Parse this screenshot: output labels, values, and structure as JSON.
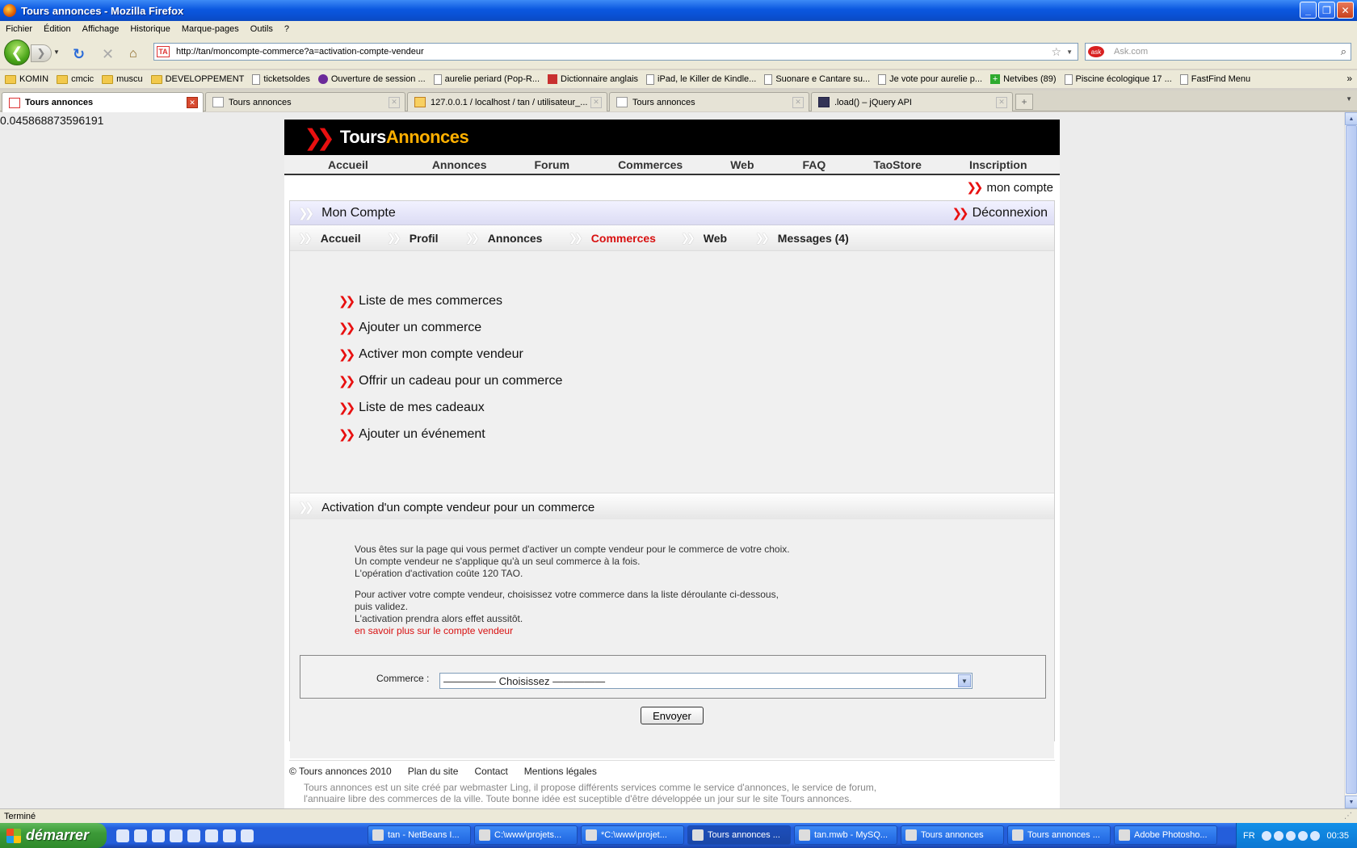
{
  "window": {
    "title": "Tours annonces - Mozilla Firefox"
  },
  "menu": [
    "Fichier",
    "Édition",
    "Affichage",
    "Historique",
    "Marque-pages",
    "Outils",
    "?"
  ],
  "nav": {
    "url": "http://tan/moncompte-commerce?a=activation-compte-vendeur",
    "search_placeholder": "Ask.com"
  },
  "bookmarks": [
    {
      "label": "KOMIN",
      "icon": "folder-icon"
    },
    {
      "label": "cmcic",
      "icon": "folder-icon"
    },
    {
      "label": "muscu",
      "icon": "folder-icon"
    },
    {
      "label": "DEVELOPPEMENT",
      "icon": "folder-icon"
    },
    {
      "label": "ticketsoldes",
      "icon": "page-icon"
    },
    {
      "label": "Ouverture de session ...",
      "icon": "yahoo-icon"
    },
    {
      "label": "aurelie periard (Pop-R...",
      "icon": "page-icon"
    },
    {
      "label": "Dictionnaire anglais",
      "icon": "wordreference-icon"
    },
    {
      "label": "iPad, le Killer de Kindle...",
      "icon": "page-icon"
    },
    {
      "label": "Suonare e Cantare su...",
      "icon": "page-icon"
    },
    {
      "label": "Je vote pour aurelie p...",
      "icon": "page-icon"
    },
    {
      "label": "Netvibes (89)",
      "icon": "plus-icon"
    },
    {
      "label": "Piscine écologique 17 ...",
      "icon": "page-icon"
    },
    {
      "label": "FastFind Menu",
      "icon": "page-icon"
    }
  ],
  "tabs": [
    {
      "label": "Tours annonces",
      "active": true
    },
    {
      "label": "Tours annonces",
      "active": false
    },
    {
      "label": "127.0.0.1 / localhost / tan / utilisateur_...",
      "active": false
    },
    {
      "label": "Tours annonces",
      "active": false
    },
    {
      "label": ".load() – jQuery API",
      "active": false
    }
  ],
  "debug_value": "0.045868873596191",
  "site": {
    "logo_part1": "Tours",
    "logo_part2": "Annonces",
    "main_nav": [
      "Accueil",
      "Annonces",
      "Forum",
      "Commerces",
      "Web",
      "FAQ",
      "TaoStore",
      "Inscription"
    ],
    "mon_compte_link": "mon compte",
    "panel_title": "Mon Compte",
    "logout": "Déconnexion",
    "sub_nav": [
      {
        "label": "Accueil",
        "current": false
      },
      {
        "label": "Profil",
        "current": false
      },
      {
        "label": "Annonces",
        "current": false
      },
      {
        "label": "Commerces",
        "current": true
      },
      {
        "label": "Web",
        "current": false
      },
      {
        "label": "Messages (4)",
        "current": false
      }
    ],
    "links": [
      "Liste de mes commerces",
      "Ajouter un commerce",
      "Activer mon compte vendeur",
      "Offrir un cadeau pour un commerce",
      "Liste de mes cadeaux",
      "Ajouter un événement"
    ],
    "section_title": "Activation d'un compte vendeur pour un commerce",
    "para1": [
      "Vous êtes sur la page qui vous permet d'activer un compte vendeur pour le commerce de votre choix.",
      "Un compte vendeur ne s'applique qu'à un seul commerce à la fois.",
      "L'opération d'activation coûte 120 TAO."
    ],
    "para2": [
      "Pour activer votre compte vendeur, choisissez votre commerce dans la liste déroulante ci-dessous,",
      "puis validez.",
      "L'activation prendra alors effet aussitôt."
    ],
    "learn_more": "en savoir plus sur le compte vendeur",
    "form": {
      "label": "Commerce :",
      "selected": "————— Choisissez —————",
      "submit": "Envoyer"
    },
    "footer": {
      "links": [
        "© Tours annonces 2010",
        "Plan du site",
        "Contact",
        "Mentions légales"
      ],
      "text": "Tours annonces est un site créé par webmaster Ling, il propose différents services comme le service d'annonces, le service de forum, l'annuaire libre des commerces de la ville. Toute bonne idée est suceptible d'être développée un jour sur le site Tours annonces."
    }
  },
  "status": "Terminé",
  "taskbar": {
    "start": "démarrer",
    "items": [
      {
        "label": "tan - NetBeans I...",
        "active": false
      },
      {
        "label": "C:\\www\\projets...",
        "active": false
      },
      {
        "label": "*C:\\www\\projet...",
        "active": false
      },
      {
        "label": "Tours annonces ...",
        "active": true
      },
      {
        "label": "tan.mwb - MySQ...",
        "active": false
      },
      {
        "label": "Tours annonces",
        "active": false
      },
      {
        "label": "Tours annonces ...",
        "active": false
      },
      {
        "label": "Adobe Photosho...",
        "active": false
      }
    ],
    "lang": "FR",
    "clock": "00:35"
  }
}
